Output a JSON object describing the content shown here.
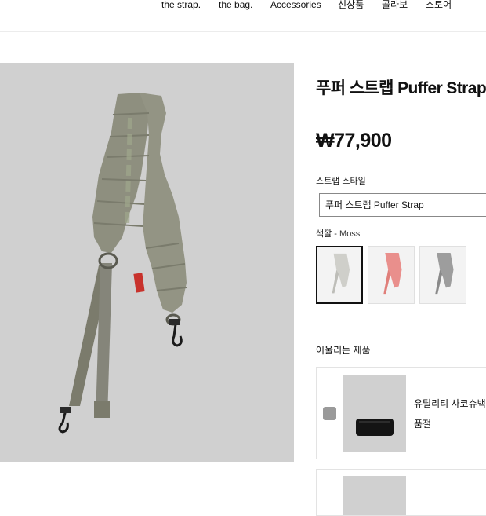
{
  "nav": {
    "items": [
      "the strap.",
      "the bag.",
      "Accessories",
      "신상품",
      "콜라보",
      "스토어"
    ]
  },
  "gallery": {
    "image": "puffer-strap-moss-photo",
    "background": "#d0d0d0",
    "strap_color": "#8e8f7f"
  },
  "product": {
    "title": "푸퍼 스트랩 Puffer Strap",
    "price": "₩77,900",
    "style_label": "스트랩 스타일",
    "style_value": "푸퍼 스트랩 Puffer Strap",
    "color_label": "색깔",
    "color_value": " - Moss",
    "swatches": [
      {
        "color": "#cfcfca",
        "selected": true
      },
      {
        "color": "#e98f8c",
        "selected": false
      },
      {
        "color": "#9d9d9d",
        "selected": false
      }
    ]
  },
  "related": {
    "title": "어울리는 제품",
    "items": [
      {
        "name": "유틸리티 사코슈백",
        "status": "품절",
        "image": "black-sacoche-bag"
      }
    ]
  }
}
